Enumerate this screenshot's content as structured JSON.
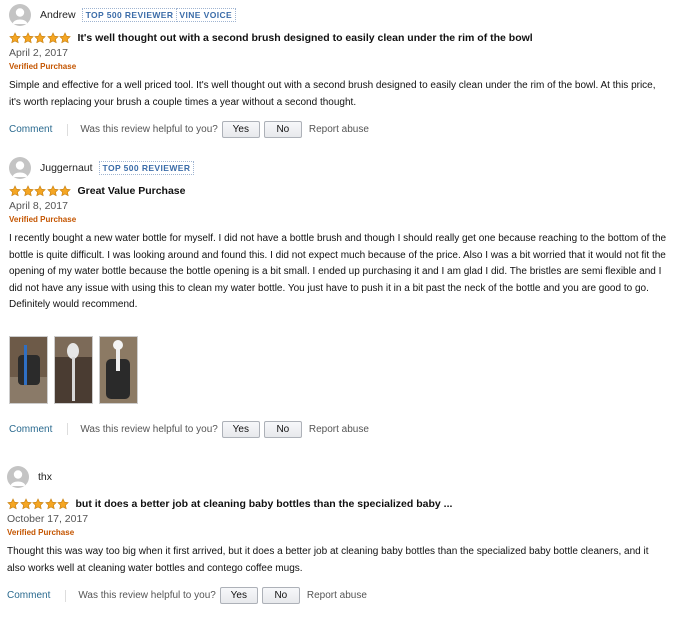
{
  "reviews": [
    {
      "username": "Andrew",
      "badges": [
        "TOP 500 REVIEWER",
        "VINE VOICE"
      ],
      "rating": 5,
      "title": "It's well thought out with a second brush designed to easily clean under the rim of the bowl",
      "date": "April 2, 2017",
      "verified": "Verified Purchase",
      "body": "Simple and effective for a well priced tool. It's well thought out with a second brush designed to easily clean under the rim of the bowl. At this price, it's worth replacing your brush a couple times a year without a second thought.",
      "comment": "Comment",
      "helpful": "Was this review helpful to you?",
      "yes": "Yes",
      "no": "No",
      "report": "Report abuse"
    },
    {
      "username": "Juggernaut",
      "badges": [
        "TOP 500 REVIEWER"
      ],
      "rating": 5,
      "title": "Great Value Purchase",
      "date": "April 8, 2017",
      "verified": "Verified Purchase",
      "body": "I recently bought a new water bottle for myself. I did not have a bottle brush and though I should really get one because reaching to the bottom of the bottle is quite difficult. I was looking around and found this. I did not expect much because of the price. Also I was a bit worried that it would not fit the opening of my water bottle because the bottle opening is a bit small. I ended up purchasing it and I am glad I did. The bristles are semi flexible and I did not have any issue with using this to clean my water bottle. You just have to push it in a bit past the neck of the bottle and you are good to go. Definitely would recommend.",
      "photos": 3,
      "comment": "Comment",
      "helpful": "Was this review helpful to you?",
      "yes": "Yes",
      "no": "No",
      "report": "Report abuse"
    },
    {
      "username": "thx",
      "badges": [],
      "rating": 5,
      "title": "but it does a better job at cleaning baby bottles than the specialized baby ...",
      "date": "October 17, 2017",
      "verified": "Verified Purchase",
      "body": "Thought this was way too big when it first arrived, but it does a better job at cleaning baby bottles than the specialized baby bottle cleaners, and it also works well at cleaning water bottles and contego coffee mugs.",
      "comment": "Comment",
      "helpful": "Was this review helpful to you?",
      "yes": "Yes",
      "no": "No",
      "report": "Report abuse"
    }
  ],
  "colors": {
    "star": "#f5a623",
    "verified": "#c45500",
    "badge": "#3b6ca8",
    "link": "#2a6a8f"
  },
  "icons": {
    "avatar": "avatar-placeholder-icon",
    "star": "star-icon"
  }
}
